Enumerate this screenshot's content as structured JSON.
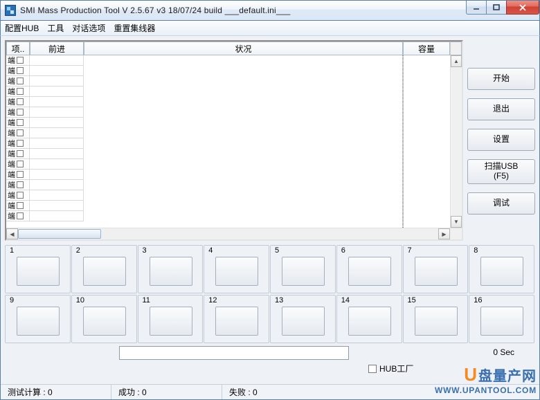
{
  "window": {
    "title": "SMI Mass Production Tool        V 2.5.67   v3        18/07/24 build        ___default.ini___"
  },
  "menu": {
    "m0": "配置HUB",
    "m1": "工具",
    "m2": "对话选项",
    "m3": "重置集线器"
  },
  "grid": {
    "h0": "项..",
    "h1": "前进",
    "h2": "状况",
    "h3": "容量",
    "rows": [
      {
        "label": "端"
      },
      {
        "label": "端"
      },
      {
        "label": "端"
      },
      {
        "label": "端"
      },
      {
        "label": "端"
      },
      {
        "label": "端"
      },
      {
        "label": "端"
      },
      {
        "label": "端"
      },
      {
        "label": "端"
      },
      {
        "label": "端"
      },
      {
        "label": "端"
      },
      {
        "label": "端"
      },
      {
        "label": "端"
      },
      {
        "label": "端"
      },
      {
        "label": "端"
      },
      {
        "label": "端"
      }
    ]
  },
  "buttons": {
    "start": "开始",
    "exit": "退出",
    "settings": "设置",
    "scan": "扫描USB\n(F5)",
    "debug": "调试"
  },
  "slots": [
    1,
    2,
    3,
    4,
    5,
    6,
    7,
    8,
    9,
    10,
    11,
    12,
    13,
    14,
    15,
    16
  ],
  "status": {
    "sec": "0 Sec",
    "hub_checkbox_label": "HUB工厂",
    "tests": "测试计算 : 0",
    "ok": "成功 : 0",
    "fail": "失败 : 0"
  },
  "watermark": {
    "cn": "盘量产网",
    "url": "WWW.UPANTOOL.COM"
  }
}
